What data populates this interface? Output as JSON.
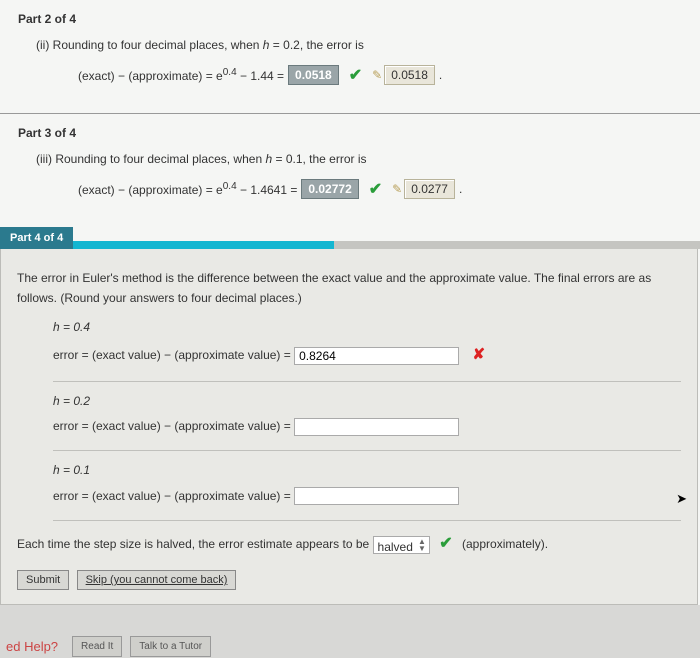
{
  "part2": {
    "heading": "Part 2 of 4",
    "prompt_prefix": "(ii) Rounding to four decimal places, when ",
    "prompt_h": "h",
    "prompt_suffix": " = 0.2, the error is",
    "eq_lhs": "(exact) − (approximate) = e",
    "eq_exp": "0.4",
    "eq_minus": " − 1.44 = ",
    "answer": "0.0518",
    "solution": "0.0518",
    "period": "."
  },
  "part3": {
    "heading": "Part 3 of 4",
    "prompt_prefix": "(iii) Rounding to four decimal places, when ",
    "prompt_h": "h",
    "prompt_suffix": " = 0.1, the error is",
    "eq_lhs": "(exact) − (approximate) = e",
    "eq_exp": "0.4",
    "eq_minus": " − 1.4641 = ",
    "answer": "0.02772",
    "solution": "0.0277",
    "period": "."
  },
  "part4": {
    "tab": "Part 4 of 4",
    "intro": "The error in Euler's method is the difference between the exact value and the approximate value. The final errors are as follows. (Round your answers to four decimal places.)",
    "items": [
      {
        "h_line": "h = 0.4",
        "err_line": "error = (exact value) − (approximate value) = ",
        "value": "0.8264",
        "show_x": true
      },
      {
        "h_line": "h = 0.2",
        "err_line": "error = (exact value) − (approximate value) = ",
        "value": "",
        "show_x": false
      },
      {
        "h_line": "h = 0.1",
        "err_line": "error = (exact value) − (approximate value) = ",
        "value": "",
        "show_x": false
      }
    ],
    "tail_before": "Each time the step size is halved, the error estimate appears to be ",
    "select_value": "halved",
    "tail_after": "(approximately).",
    "submit": "Submit",
    "skip": "Skip (you cannot come back)"
  },
  "help": {
    "label": "ed Help?",
    "read": "Read It",
    "talk": "Talk to a Tutor"
  }
}
